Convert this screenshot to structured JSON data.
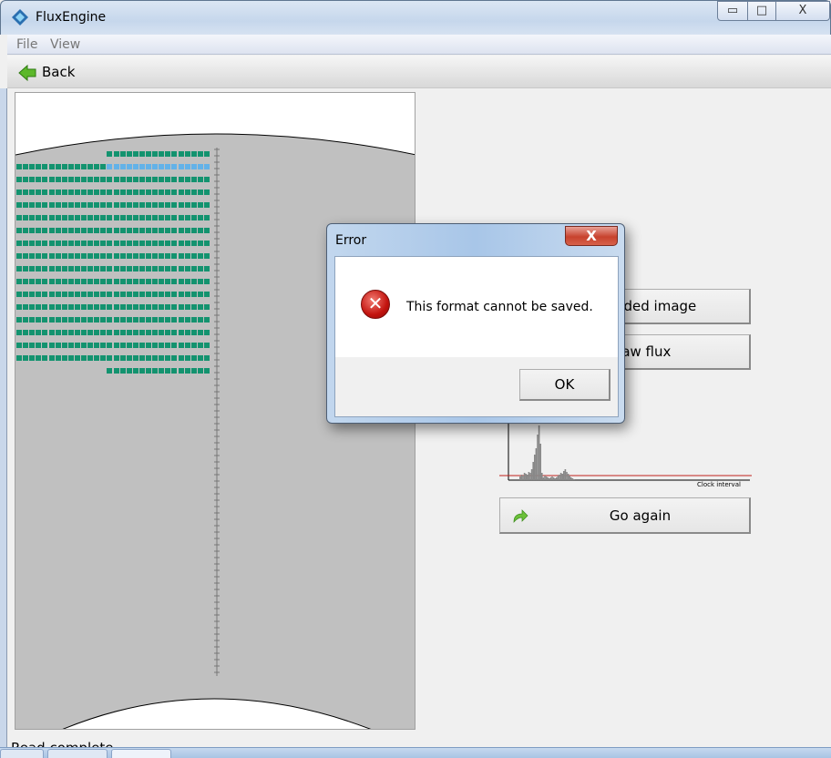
{
  "window": {
    "title": "FluxEngine",
    "minimize": "▭",
    "maximize": "□",
    "close": "X"
  },
  "menu": [
    {
      "label": "File"
    },
    {
      "label": "View"
    }
  ],
  "toolbar": {
    "back_label": "Back"
  },
  "actions": {
    "save_image": "Save decoded image",
    "save_flux": "Save raw flux",
    "go_again": "Go again"
  },
  "histogram": {
    "xlabel": "Clock interval"
  },
  "status": "Read complete",
  "dialog": {
    "title": "Error",
    "message": "This format cannot be saved.",
    "ok": "OK",
    "close": "X",
    "icon": "error-icon"
  },
  "disk": {
    "rows_full": 16,
    "sectors_per_row": 30,
    "partial_sectors": 16,
    "colors": {
      "good": "#13936f",
      "selected": "#63b2e8",
      "background": "#c0c0c0"
    }
  }
}
